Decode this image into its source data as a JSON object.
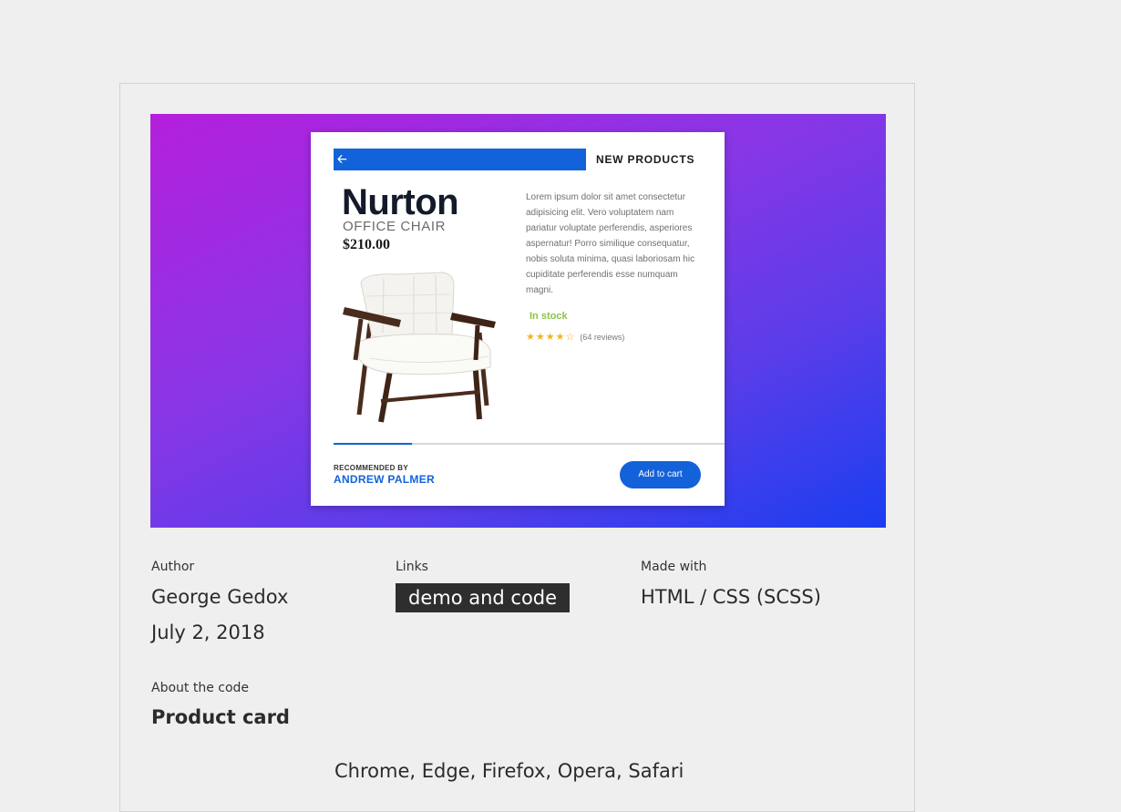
{
  "product_card": {
    "header_label": "NEW PRODUCTS",
    "back_icon": "arrow-left-icon",
    "name": "Nurton",
    "subtitle": "OFFICE CHAIR",
    "price": "$210.00",
    "description": "Lorem ipsum dolor sit amet consectetur adipisicing elit. Vero voluptatem nam pariatur voluptate perferendis, asperiores aspernatur! Porro similique consequatur, nobis soluta minima, quasi laboriosam hic cupiditate perferendis esse numquam magni.",
    "stock": "In stock",
    "rating": {
      "value": 4,
      "max": 5
    },
    "reviews": "(64 reviews)",
    "progress_fraction": 0.2,
    "recommended_label": "RECOMMENDED BY",
    "recommended_name": "ANDREW PALMER",
    "add_to_cart": "Add to cart",
    "colors": {
      "accent": "#1362d9",
      "stock": "#8bc34a",
      "stars": "#f5b320"
    }
  },
  "meta": {
    "author_label": "Author",
    "author_name": "George Gedox",
    "date": "July 2, 2018",
    "links_label": "Links",
    "link_text": "demo and code",
    "made_with_label": "Made with",
    "made_with_value": "HTML / CSS (SCSS)",
    "about_label": "About the code",
    "about_title": "Product card",
    "browsers": "Chrome, Edge, Firefox, Opera, Safari"
  }
}
